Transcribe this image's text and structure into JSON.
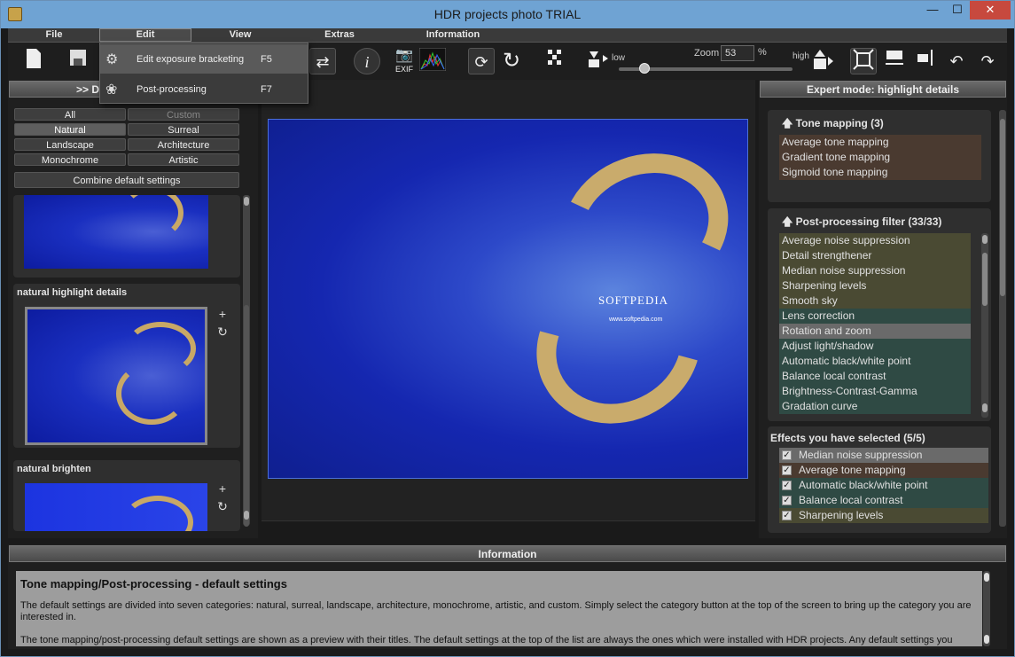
{
  "window": {
    "title": "HDR projects photo  TRIAL"
  },
  "menu": [
    "File",
    "Edit",
    "View",
    "Extras",
    "Information"
  ],
  "edit_menu": {
    "items": [
      {
        "label": "Edit exposure bracketing",
        "shortcut": "F5"
      },
      {
        "label": "Post-processing",
        "shortcut": "F7"
      }
    ]
  },
  "toolbar": {
    "zoom_label": "Zoom",
    "zoom_value": "53",
    "zoom_unit": "%",
    "zoom_low": "low",
    "zoom_high": "high",
    "exif_label": "EXIF",
    "zoom_level": 0.15
  },
  "left": {
    "header": ">> D",
    "categories": [
      "All",
      "Custom",
      "Natural",
      "Surreal",
      "Landscape",
      "Architecture",
      "Monochrome",
      "Artistic"
    ],
    "combine_label": "Combine default settings",
    "cards": [
      {
        "title": ""
      },
      {
        "title": "natural highlight details"
      },
      {
        "title": "natural brighten"
      }
    ]
  },
  "photo": {
    "watermark": "SOFTPEDIA",
    "watermark_url": "www.softpedia.com"
  },
  "right": {
    "header": "Expert mode: highlight details",
    "tone_title": "Tone mapping (3)",
    "tone_items": [
      "Average tone mapping",
      "Gradient tone mapping",
      "Sigmoid tone mapping"
    ],
    "filter_title": "Post-processing filter (33/33)",
    "filter_items": [
      "Average noise suppression",
      "Detail strengthener",
      "Median noise suppression",
      "Sharpening levels",
      "Smooth sky",
      "Lens correction",
      "Rotation and zoom",
      "Adjust light/shadow",
      "Automatic black/white point",
      "Balance local contrast",
      "Brightness-Contrast-Gamma",
      "Gradation curve"
    ],
    "selected_title": "Effects you have selected (5/5)",
    "selected_items": [
      "Median noise suppression",
      "Average tone mapping",
      "Automatic black/white point",
      "Balance local contrast",
      "Sharpening levels"
    ]
  },
  "info": {
    "header": "Information",
    "heading": "Tone mapping/Post-processing - default settings",
    "p1": "The default settings are divided into seven categories: natural, surreal, landscape, architecture, monochrome, artistic, and custom. Simply select the category button at the top of the screen to bring up the category you are interested in.",
    "p2": "The tone mapping/post-processing default settings are shown as a preview with their titles. The default settings at the top of the list are always the ones which were installed with HDR projects. Any default settings you"
  },
  "colors": {
    "tone_bg": "#4a3a30",
    "filter_olive": "#4a4a33",
    "filter_teal": "#2f4a44",
    "selected_row": "#6a6a6a"
  }
}
